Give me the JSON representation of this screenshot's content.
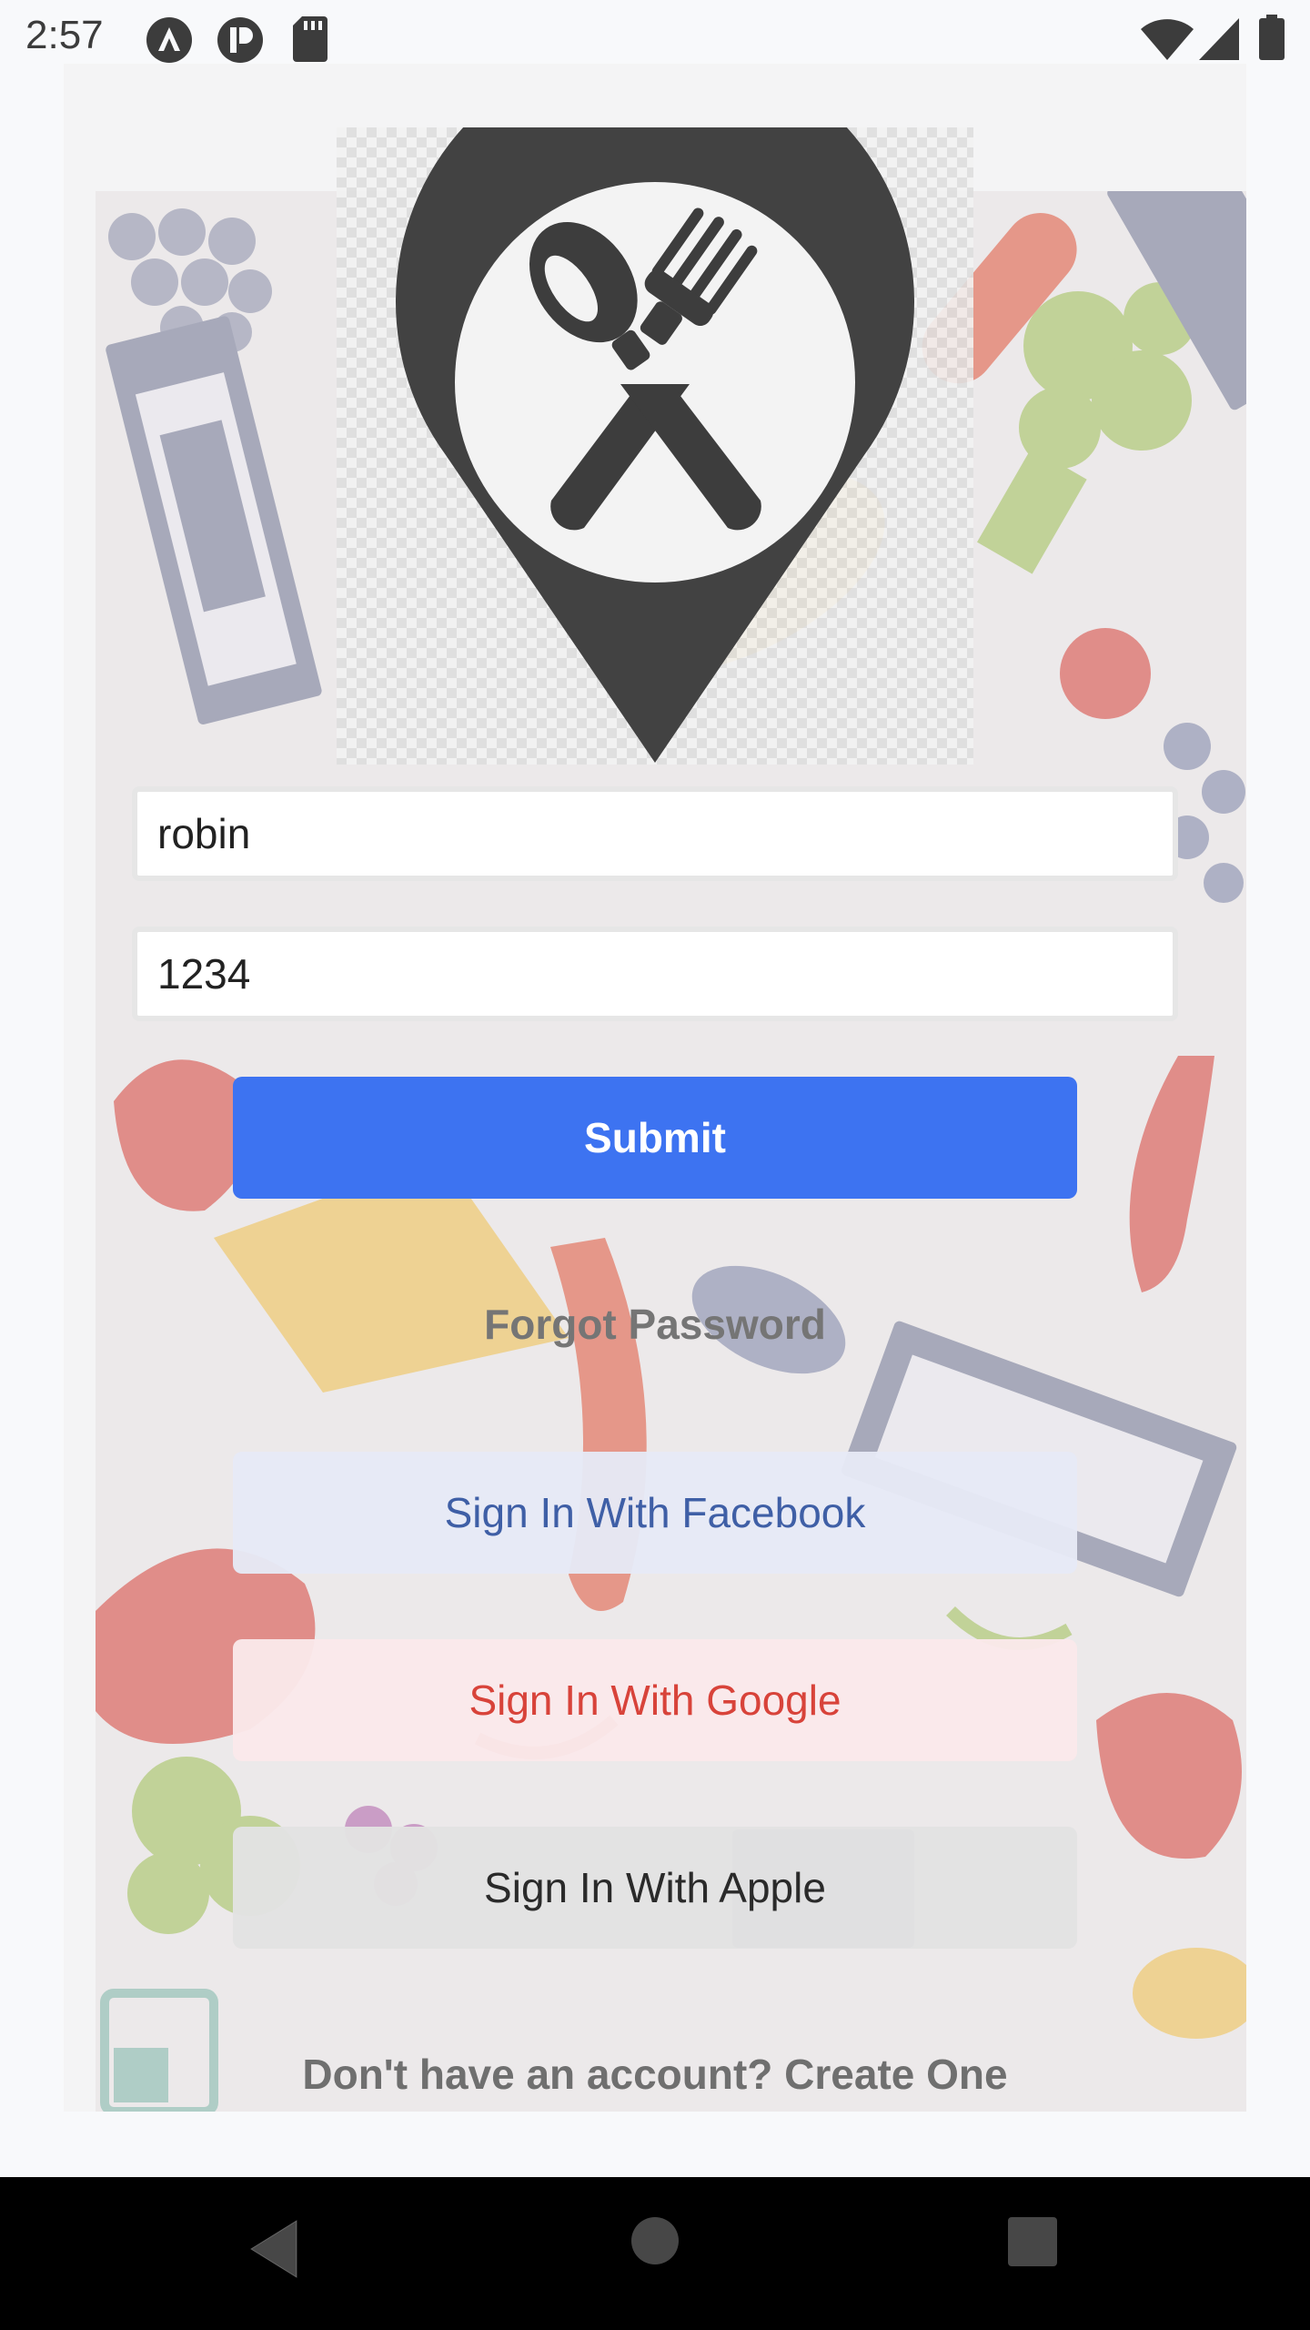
{
  "status_bar": {
    "time": "2:57",
    "left_icons": [
      "app-a-icon",
      "app-p-icon",
      "sd-card-icon"
    ],
    "right_icons": [
      "wifi-icon",
      "cell-signal-icon",
      "battery-icon"
    ]
  },
  "logo": {
    "icon": "location-pin-fork-spoon-icon",
    "color": "#3d3d3d"
  },
  "form": {
    "username_value": "robin",
    "password_value": "1234"
  },
  "buttons": {
    "submit_label": "Submit",
    "forgot_label": "Forgot Password",
    "facebook_label": "Sign In With Facebook",
    "google_label": "Sign In With Google",
    "apple_label": "Sign In With Apple",
    "create_account_label": "Don't have an account? Create One"
  },
  "colors": {
    "submit_bg": "#3d73f1",
    "facebook_text": "#3f5fa6",
    "google_text": "#d8433a"
  },
  "nav_bar": {
    "icons": [
      "back-icon",
      "home-icon",
      "recents-icon"
    ]
  }
}
